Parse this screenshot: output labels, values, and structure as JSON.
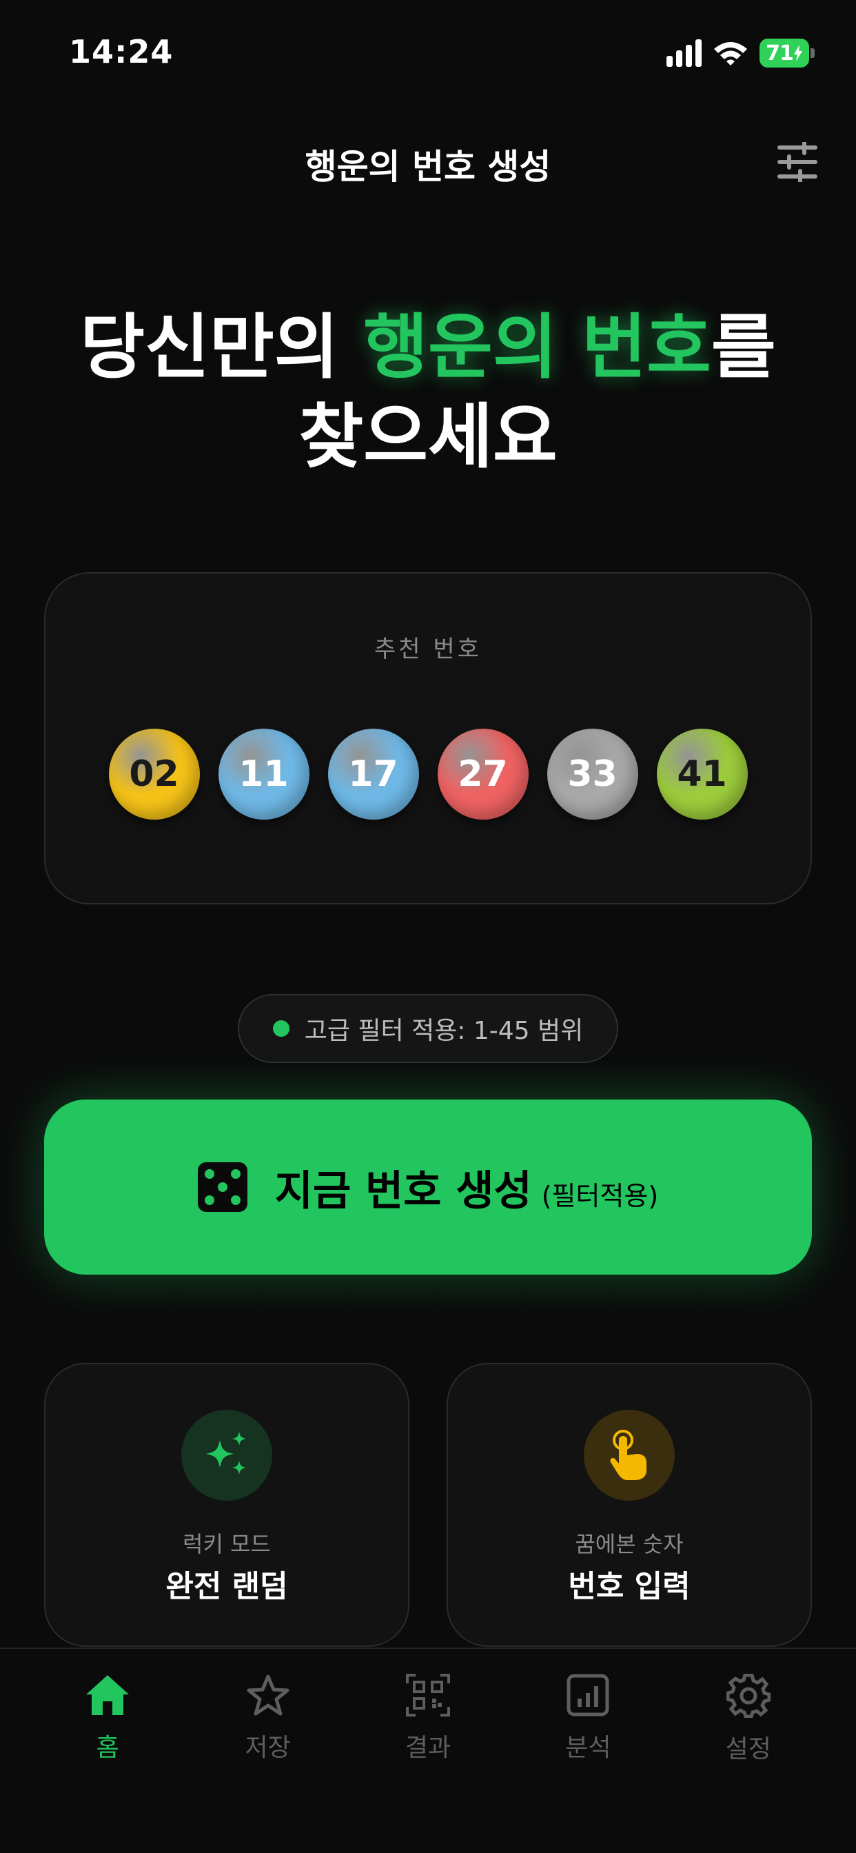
{
  "status_bar": {
    "time": "14:24",
    "battery": "71"
  },
  "header": {
    "title": "행운의 번호 생성",
    "settings_icon": "sliders-icon"
  },
  "hero": {
    "line1_prefix": "당신만의 ",
    "line1_accent": "행운의 번호",
    "line1_suffix": "를",
    "line2": "찾으세요"
  },
  "recommend": {
    "label": "추천 번호",
    "balls": [
      {
        "number": "02",
        "color": "#f5c218",
        "text_color": "#1a1a1a"
      },
      {
        "number": "11",
        "color": "#6fb8e6",
        "text_color": "#ffffff"
      },
      {
        "number": "17",
        "color": "#6fb8e6",
        "text_color": "#ffffff"
      },
      {
        "number": "27",
        "color": "#ef6262",
        "text_color": "#ffffff"
      },
      {
        "number": "33",
        "color": "#a9a9a9",
        "text_color": "#ffffff"
      },
      {
        "number": "41",
        "color": "#9ccc3c",
        "text_color": "#1a1a1a"
      }
    ]
  },
  "filter_pill": {
    "text": "고급 필터 적용: 1-45 범위",
    "dot_color": "#22c55e"
  },
  "generate_button": {
    "label": "지금 번호 생성",
    "sub_label": "(필터적용)",
    "icon": "dice-icon",
    "color": "#22c55e"
  },
  "modes": [
    {
      "subtitle": "럭키 모드",
      "title": "완전 랜덤",
      "icon": "sparkles-icon"
    },
    {
      "subtitle": "꿈에본 숫자",
      "title": "번호 입력",
      "icon": "tap-hand-icon"
    }
  ],
  "tabs": [
    {
      "label": "홈",
      "icon": "home-icon",
      "active": true
    },
    {
      "label": "저장",
      "icon": "star-icon",
      "active": false
    },
    {
      "label": "결과",
      "icon": "qr-code-icon",
      "active": false
    },
    {
      "label": "분석",
      "icon": "chart-icon",
      "active": false
    },
    {
      "label": "설정",
      "icon": "gear-icon",
      "active": false
    }
  ],
  "colors": {
    "accent": "#22c55e",
    "background": "#0b0b0b",
    "card": "#121212"
  }
}
